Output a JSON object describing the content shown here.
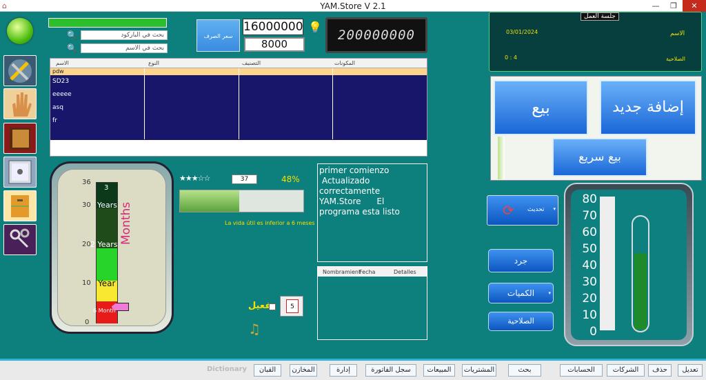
{
  "window": {
    "title": "YAM.Store V 2.1"
  },
  "search": {
    "by_barcode": "بحث في الباركود",
    "by_name": "بحث في الاسم"
  },
  "exchange": {
    "label": "سعر الصرف",
    "value1": "16000000",
    "value2": "8000"
  },
  "led_display": "200000000",
  "grid": {
    "headers": [
      "الاسم",
      "النوع",
      "التصنيف",
      "المكونات"
    ],
    "rows": [
      "pdw",
      "SD23",
      "eeeee",
      "asq",
      "fr"
    ]
  },
  "session": {
    "title": "جلسة العمل",
    "date": "03/01/2024",
    "name_label": "الاسم",
    "time": "0 : 4",
    "permission_label": "الصلاحية"
  },
  "actions": {
    "add_new": "إضافة جديد",
    "sell": "بيع",
    "quick_sell": "بيع سريع",
    "refresh": "تحديث",
    "inventory": "جرد",
    "quantities": "الكميات",
    "permissions": "الصلاحية"
  },
  "progress": {
    "stars_filled": 3,
    "stars_total": 5,
    "count": "37",
    "percent": "48%",
    "fraction": 0.48,
    "note": "La vida útil es inferior a 6 meses"
  },
  "log": {
    "text": "primer comienzo\n Actualizado correctamente\nYAM.Store      El programa esta listo",
    "headers": [
      "Nombramient",
      "Fecha",
      "Detalles"
    ]
  },
  "activate": {
    "label": "تفعيل"
  },
  "months_gauge": {
    "title": "Months",
    "ticks": [
      "36",
      "30",
      "20",
      "10",
      "0"
    ],
    "labels": [
      "3",
      "Years",
      "2 Years",
      "Year",
      "6 Month"
    ]
  },
  "thermo": {
    "ticks": [
      "80",
      "70",
      "60",
      "50",
      "40",
      "30",
      "20",
      "10",
      "0"
    ],
    "level": 0.7
  },
  "taskbar": [
    "تعديل",
    "حذف",
    "الشركات",
    "الحسابات",
    "بحث",
    "المشتريات",
    "المبيعات",
    "سجل الفاتورة",
    "إدارة",
    "المخازن",
    "القبان",
    "Dictionary"
  ],
  "colors": {
    "bg": "#0d7f7c",
    "grid_row": "#17166b",
    "selected_row": "#fcd48c",
    "accent": "#2fb3de"
  }
}
